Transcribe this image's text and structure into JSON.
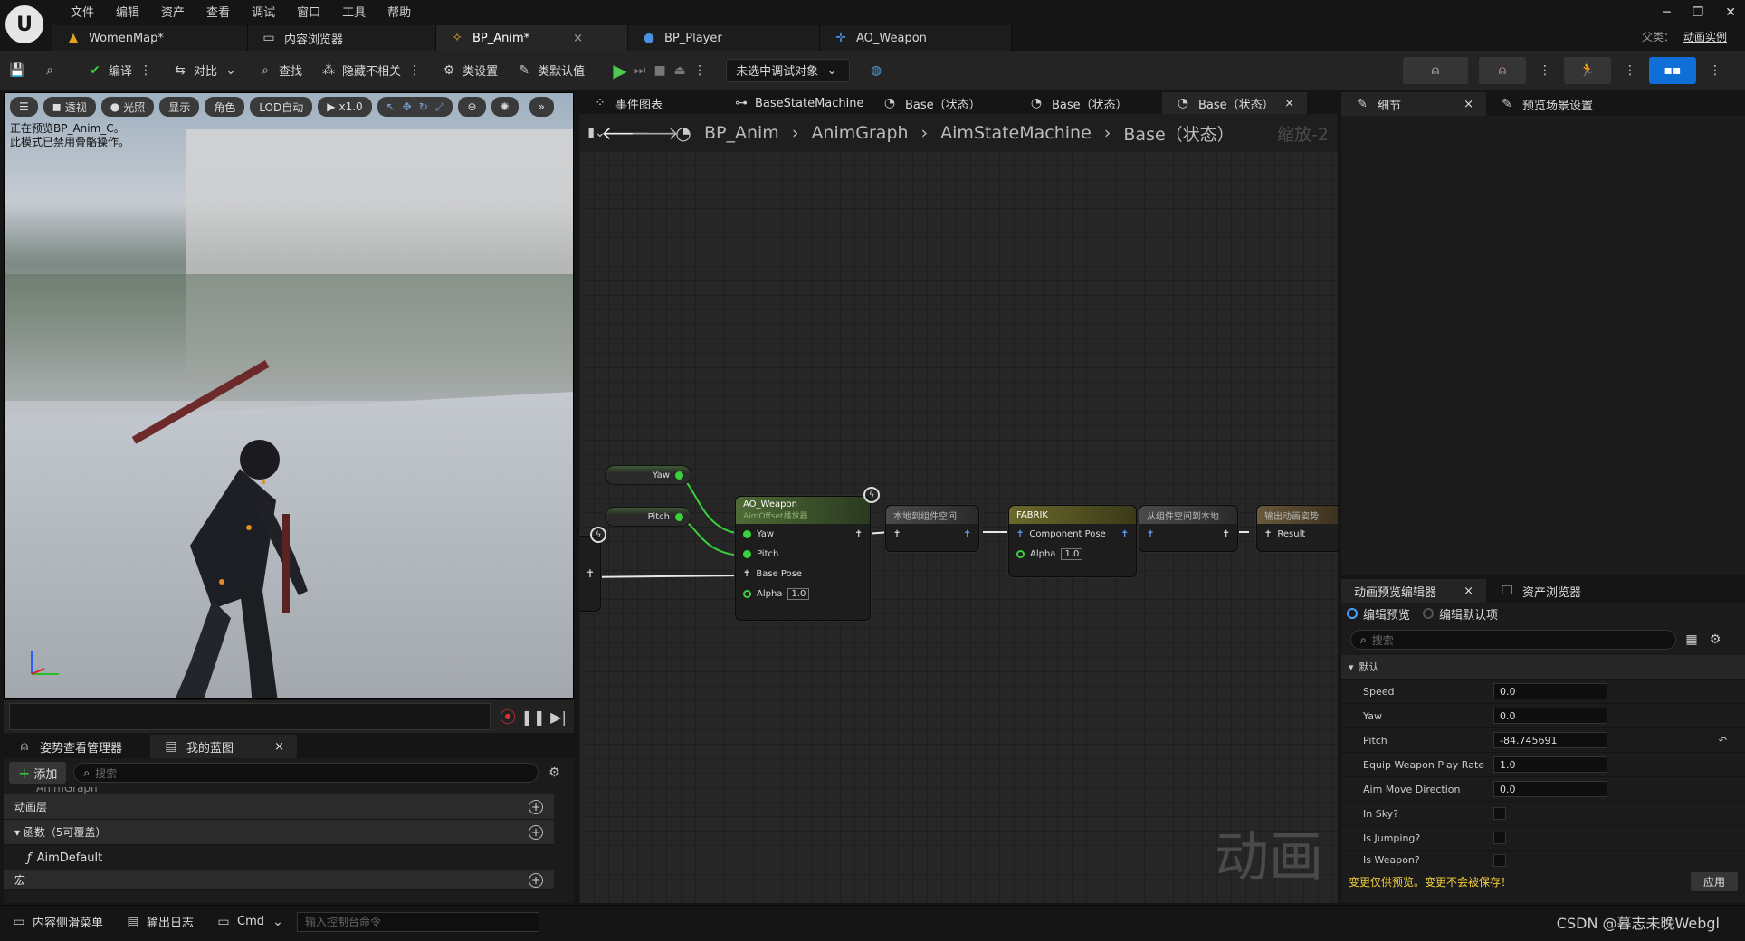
{
  "menu": [
    "文件",
    "编辑",
    "资产",
    "查看",
    "调试",
    "窗口",
    "工具",
    "帮助"
  ],
  "doc_tabs": [
    {
      "label": "WomenMap*"
    },
    {
      "label": "内容浏览器"
    },
    {
      "label": "BP_Anim*",
      "close": "×"
    },
    {
      "label": "BP_Player"
    },
    {
      "label": "AO_Weapon"
    }
  ],
  "parent": {
    "label": "父类：",
    "value": "动画实例"
  },
  "toolbar": {
    "compile": "编译",
    "diff": "对比",
    "find": "查找",
    "hide_unrelated": "隐藏不相关",
    "class_settings": "类设置",
    "class_defaults": "类默认值",
    "debug_target": "未选中调试对象"
  },
  "viewport": {
    "pills": [
      "透视",
      "光照",
      "显示",
      "角色",
      "LOD自动",
      "x1.0"
    ],
    "message_line1": "正在预览BP_Anim_C。",
    "message_line2": "此模式已禁用骨骼操作。"
  },
  "bottom_left": {
    "tabs": [
      "姿势查看管理器",
      "我的蓝图"
    ],
    "add_label": "添加",
    "search_placeholder": "搜索",
    "tree_hint": "AnimGraph",
    "sections": [
      "动画层",
      "函数（5可覆盖）",
      "宏"
    ],
    "func_item": "AimDefault"
  },
  "graph": {
    "tabs": [
      "事件图表",
      "BaseStateMachine",
      "Base（状态）",
      "Base（状态）",
      "Base（状态）"
    ],
    "breadcrumbs": [
      "BP_Anim",
      "AnimGraph",
      "AimStateMachine",
      "Base（状态）"
    ],
    "zoom": "缩放-2",
    "watermark": "动画",
    "vars": {
      "yaw": "Yaw",
      "pitch": "Pitch"
    },
    "ao_node": {
      "title": "AO_Weapon",
      "subtitle": "AimOffset播放器",
      "pins": [
        "Yaw",
        "Pitch",
        "Base Pose",
        "Alpha"
      ],
      "alpha": "1.0"
    },
    "local_to_component": "本地到组件空间",
    "fabrik": {
      "title": "FABRIK",
      "pin": "Component Pose",
      "alpha_label": "Alpha",
      "alpha": "1.0"
    },
    "component_to_local": "从组件空间到本地",
    "output_pose": {
      "title": "输出动画姿势",
      "pin": "Result"
    }
  },
  "details": {
    "tab1": "细节",
    "tab2": "预览场景设置"
  },
  "preview": {
    "tab1": "动画预览编辑器",
    "tab2": "资产浏览器",
    "radio_edit_preview": "编辑预览",
    "radio_edit_defaults": "编辑默认项",
    "search_placeholder": "搜索",
    "category": "默认",
    "props": [
      {
        "label": "Speed",
        "value": "0.0"
      },
      {
        "label": "Yaw",
        "value": "0.0"
      },
      {
        "label": "Pitch",
        "value": "-84.745691"
      },
      {
        "label": "Equip Weapon Play Rate",
        "value": "1.0"
      },
      {
        "label": "Aim Move Direction",
        "value": "0.0"
      }
    ],
    "bools": [
      "In Sky?",
      "Is Jumping?",
      "Is Weapon?"
    ],
    "notice": "变更仅供预览。变更不会被保存！",
    "apply": "应用"
  },
  "statusbar": {
    "content_drawer": "内容侧滑菜单",
    "output_log": "输出日志",
    "cmd": "Cmd",
    "console_placeholder": "输入控制台命令",
    "credit": "CSDN @暮志未晚Webgl"
  },
  "colors": {
    "accent": "#0f6fd6",
    "exec_green": "#39d23a",
    "notice": "#f2d03c"
  }
}
